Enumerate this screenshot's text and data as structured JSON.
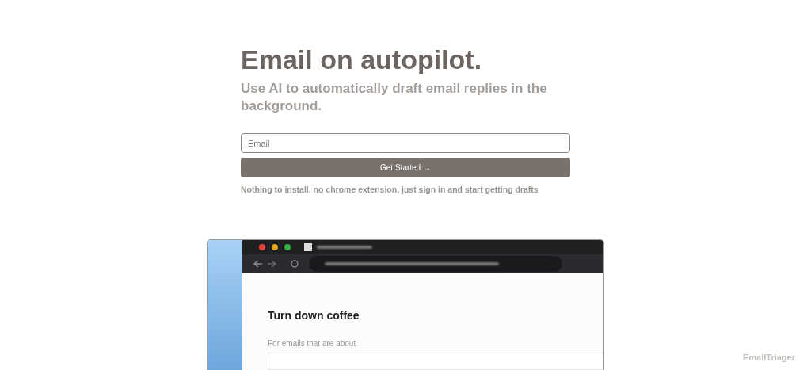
{
  "hero": {
    "title": "Email on autopilot.",
    "subtitle": "Use AI to automatically draft email replies in the background."
  },
  "signup": {
    "placeholder": "Email",
    "button": "Get Started →",
    "note": "Nothing to install, no chrome extension, just sign in and start getting drafts"
  },
  "demo": {
    "heading": "Turn down coffee",
    "field_label": "For emails that are about"
  },
  "brand": "EmailTriager"
}
